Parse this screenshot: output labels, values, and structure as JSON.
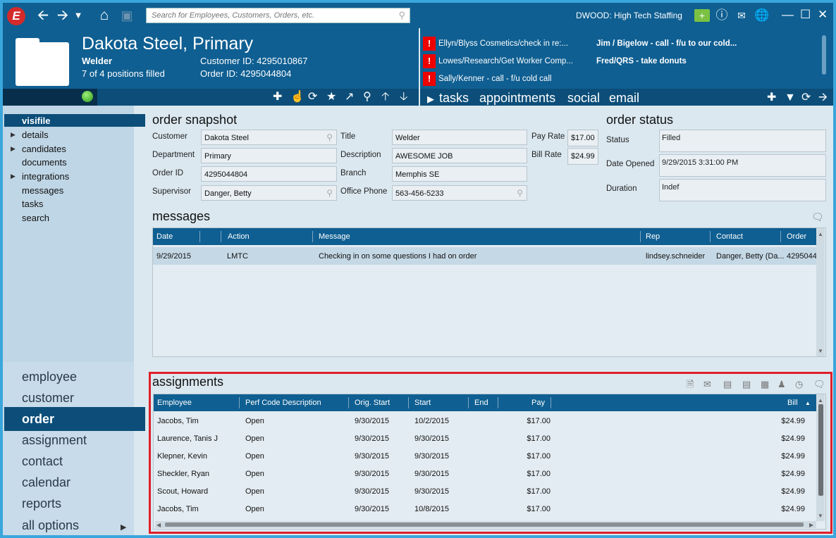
{
  "topbar": {
    "logo_letter": "E",
    "search_placeholder": "Search for Employees, Customers, Orders, etc.",
    "user_text": "DWOOD: High Tech Staffing"
  },
  "header": {
    "title": "Dakota Steel, Primary",
    "position": "Welder",
    "filled": "7 of 4 positions filled",
    "customer_id": "Customer ID: 4295010867",
    "order_id": "Order ID: 4295044804"
  },
  "alerts": {
    "items": [
      {
        "text": "Ellyn/Blyss Cosmetics/check in re:...",
        "right": "Jim / Bigelow - call - f/u to our cold..."
      },
      {
        "text": "Lowes/Research/Get Worker Comp...",
        "right": "Fred/QRS - take donuts"
      },
      {
        "text": "Sally/Kenner - call - f/u cold call",
        "right": ""
      }
    ],
    "tabs": {
      "tasks": "tasks",
      "appointments": "appointments",
      "social": "social",
      "email": "email"
    }
  },
  "nav": {
    "top_items": [
      "visifile",
      "details",
      "candidates",
      "documents",
      "integrations",
      "messages",
      "tasks",
      "search"
    ],
    "big_items": [
      "employee",
      "customer",
      "order",
      "assignment",
      "contact",
      "calendar",
      "reports",
      "all options"
    ]
  },
  "snapshot": {
    "title": "order snapshot",
    "labels": {
      "customer": "Customer",
      "department": "Department",
      "order_id": "Order ID",
      "supervisor": "Supervisor",
      "title": "Title",
      "description": "Description",
      "branch": "Branch",
      "office_phone": "Office Phone",
      "pay_rate": "Pay Rate",
      "bill_rate": "Bill Rate"
    },
    "values": {
      "customer": "Dakota Steel",
      "department": "Primary",
      "order_id": "4295044804",
      "supervisor": "Danger, Betty",
      "title": "Welder",
      "description": "AWESOME JOB",
      "branch": "Memphis SE",
      "office_phone": "563-456-5233",
      "pay_rate": "$17.00",
      "bill_rate": "$24.99"
    }
  },
  "status": {
    "title": "order status",
    "labels": {
      "status": "Status",
      "date_opened": "Date Opened",
      "duration": "Duration"
    },
    "values": {
      "status": "Filled",
      "date_opened": "9/29/2015 3:31:00 PM",
      "duration": "Indef"
    }
  },
  "messages": {
    "title": "messages",
    "columns": [
      "Date",
      "",
      "Action",
      "Message",
      "Rep",
      "Contact",
      "Order"
    ],
    "rows": [
      {
        "date": "9/29/2015",
        "action": "LMTC",
        "message": "Checking in on some questions I had on order",
        "rep": "lindsey.schneider",
        "contact": "Danger, Betty (Da...",
        "order": "4295044"
      }
    ]
  },
  "assignments": {
    "title": "assignments",
    "columns": [
      "Employee",
      "Perf Code Description",
      "Orig. Start",
      "Start",
      "End",
      "Pay",
      "Bill"
    ],
    "rows": [
      {
        "employee": "Jacobs, Tim",
        "perf": "Open",
        "orig": "9/30/2015",
        "start": "10/2/2015",
        "end": "",
        "pay": "$17.00",
        "bill": "$24.99"
      },
      {
        "employee": "Laurence, Tanis J",
        "perf": "Open",
        "orig": "9/30/2015",
        "start": "9/30/2015",
        "end": "",
        "pay": "$17.00",
        "bill": "$24.99"
      },
      {
        "employee": "Klepner, Kevin",
        "perf": "Open",
        "orig": "9/30/2015",
        "start": "9/30/2015",
        "end": "",
        "pay": "$17.00",
        "bill": "$24.99"
      },
      {
        "employee": "Sheckler, Ryan",
        "perf": "Open",
        "orig": "9/30/2015",
        "start": "9/30/2015",
        "end": "",
        "pay": "$17.00",
        "bill": "$24.99"
      },
      {
        "employee": "Scout, Howard",
        "perf": "Open",
        "orig": "9/30/2015",
        "start": "9/30/2015",
        "end": "",
        "pay": "$17.00",
        "bill": "$24.99"
      },
      {
        "employee": "Jacobs, Tim",
        "perf": "Open",
        "orig": "9/30/2015",
        "start": "10/8/2015",
        "end": "",
        "pay": "$17.00",
        "bill": "$24.99"
      }
    ]
  }
}
